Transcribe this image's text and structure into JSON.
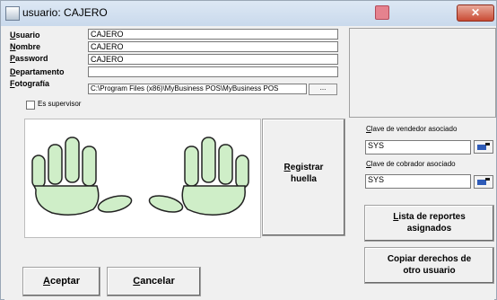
{
  "window": {
    "title": "usuario: CAJERO",
    "close_glyph": "✕"
  },
  "form": {
    "usuario_label_first": "U",
    "usuario_label_rest": "suario",
    "usuario_value": "CAJERO",
    "nombre_label_first": "N",
    "nombre_label_rest": "ombre",
    "nombre_value": "CAJERO",
    "password_label_first": "P",
    "password_label_rest": "assword",
    "password_value": "CAJERO",
    "departamento_label_first": "D",
    "departamento_label_rest": "epartamento",
    "departamento_value": "",
    "fotografia_label_first": "F",
    "fotografia_label_rest": "otografía",
    "fotografia_value": "C:\\Program Files (x86)\\MyBusiness POS\\MyBusiness POS",
    "browse_label": "...",
    "supervisor_label": "Es supervisor",
    "supervisor_checked": false
  },
  "fingerprint": {
    "register_label_first": "R",
    "register_label_rest": "egistrar",
    "register_label_line2": "huella"
  },
  "right": {
    "vendedor_label_first": "C",
    "vendedor_label_rest": "lave de vendedor asociado",
    "vendedor_value": "SYS",
    "cobrador_label_first": "C",
    "cobrador_label_rest": "lave de cobrador asociado",
    "cobrador_value": "SYS",
    "reportes_line1_first": "L",
    "reportes_line1_rest": "ista de reportes",
    "reportes_line2": "asignados",
    "copiar_line1": "Copiar derechos de",
    "copiar_line2": "otro usuario"
  },
  "footer": {
    "aceptar_first": "A",
    "aceptar_rest": "ceptar",
    "cancelar_first": "C",
    "cancelar_rest": "ancelar"
  },
  "colors": {
    "hand_fill": "#cfeec8",
    "hand_stroke": "#222222"
  }
}
